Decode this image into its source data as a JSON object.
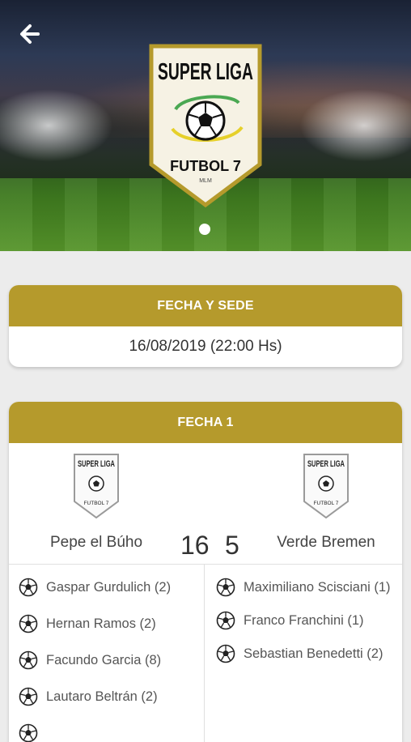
{
  "hero": {
    "logo_top": "SUPER LIGA",
    "logo_bottom": "FUTBOL 7",
    "logo_small": "MLM"
  },
  "schedule": {
    "header": "FECHA Y SEDE",
    "datetime": "16/08/2019 (22:00 Hs)"
  },
  "match": {
    "header": "FECHA 1",
    "home_team": "Pepe el Búho",
    "away_team": "Verde Bremen",
    "home_score": "16",
    "away_score": "5",
    "home_scorers": [
      "Gaspar Gurdulich (2)",
      "Hernan Ramos (2)",
      "Facundo Garcia (8)",
      "Lautaro Beltrán (2)"
    ],
    "away_scorers": [
      "Maximiliano Scisciani (1)",
      "Franco Franchini (1)",
      "Sebastian Benedetti (2)"
    ]
  },
  "colors": {
    "gold": "#b59a2c",
    "card": "#ffffff",
    "background": "#ececec"
  },
  "icons": {
    "back": "arrow-left-icon",
    "goal": "soccer-ball-icon",
    "logo": "super-liga-shield-logo"
  }
}
